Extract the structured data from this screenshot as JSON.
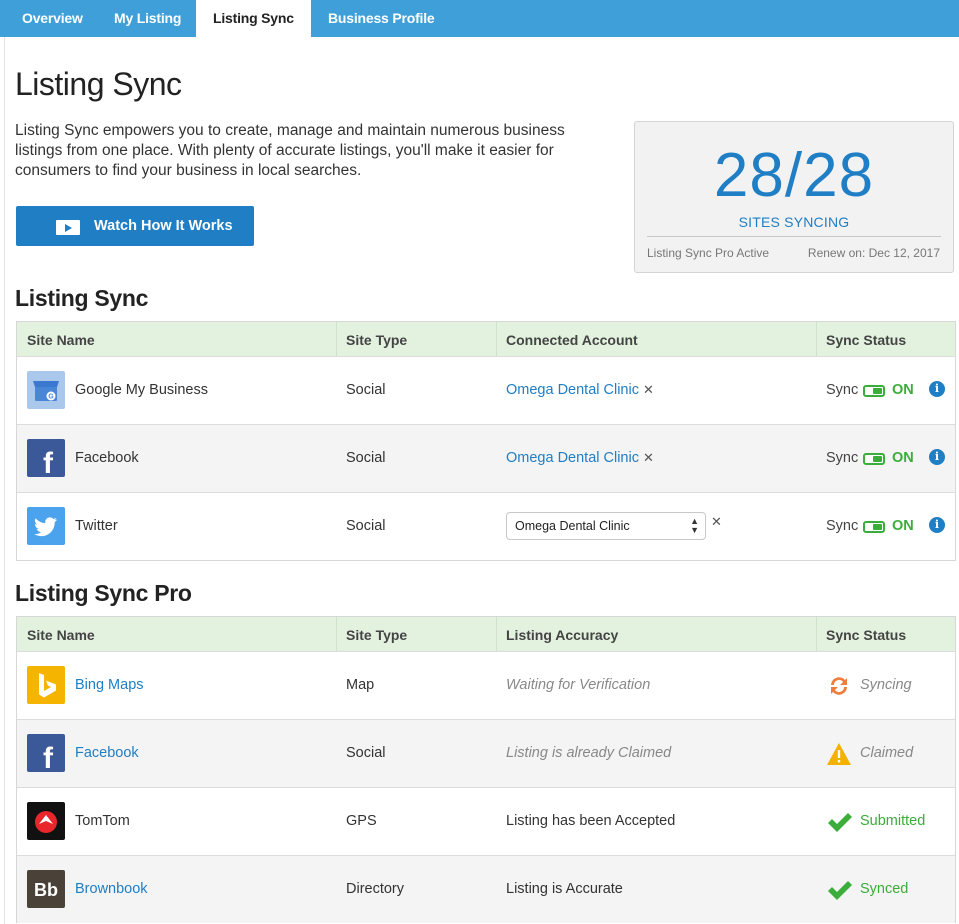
{
  "nav": {
    "tabs": [
      "Overview",
      "My Listing",
      "Listing Sync",
      "Business Profile"
    ],
    "active_index": 2
  },
  "page": {
    "title": "Listing Sync",
    "intro": "Listing Sync empowers you to create, manage and maintain numerous business listings from one place. With plenty of accurate listings, you'll make it easier for consumers to find your business in local searches.",
    "watch_button": "Watch How It Works"
  },
  "summary": {
    "count": "28/28",
    "label": "SITES SYNCING",
    "plan": "Listing Sync Pro Active",
    "renew": "Renew on: Dec 12, 2017"
  },
  "listing_sync": {
    "title": "Listing Sync",
    "headers": [
      "Site Name",
      "Site Type",
      "Connected Account",
      "Sync Status"
    ],
    "rows": [
      {
        "site": "Google My Business",
        "icon": "google-my-business-icon",
        "type": "Social",
        "account": "Omega Dental Clinic",
        "account_mode": "link",
        "sync_label": "Sync",
        "sync_state": "ON"
      },
      {
        "site": "Facebook",
        "icon": "facebook-icon",
        "type": "Social",
        "account": "Omega Dental Clinic",
        "account_mode": "link",
        "sync_label": "Sync",
        "sync_state": "ON"
      },
      {
        "site": "Twitter",
        "icon": "twitter-icon",
        "type": "Social",
        "account": "Omega Dental Clinic",
        "account_mode": "select",
        "sync_label": "Sync",
        "sync_state": "ON"
      }
    ]
  },
  "listing_sync_pro": {
    "title": "Listing Sync Pro",
    "headers": [
      "Site Name",
      "Site Type",
      "Listing Accuracy",
      "Sync Status"
    ],
    "rows": [
      {
        "site": "Bing Maps",
        "icon": "bing-icon",
        "type": "Map",
        "accuracy": "Waiting for Verification",
        "status": "Syncing",
        "status_icon": "syncing-icon"
      },
      {
        "site": "Facebook",
        "icon": "facebook-icon",
        "type": "Social",
        "accuracy": "Listing is already Claimed",
        "status": "Claimed",
        "status_icon": "warning-icon"
      },
      {
        "site": "TomTom",
        "icon": "tomtom-icon",
        "type": "GPS",
        "accuracy": "Listing has been Accepted",
        "status": "Submitted",
        "status_icon": "checkmark-icon"
      },
      {
        "site": "Brownbook",
        "icon": "brownbook-icon",
        "type": "Directory",
        "accuracy": "Listing is Accurate",
        "status": "Synced",
        "status_icon": "checkmark-icon"
      }
    ]
  },
  "colors": {
    "nav_bg": "#3fa0d9",
    "accent_blue": "#1f7ec4",
    "header_green": "#e3f2df",
    "on_green": "#3aad3a",
    "warning": "#f3b100",
    "syncing_orange": "#ef7d3c"
  }
}
